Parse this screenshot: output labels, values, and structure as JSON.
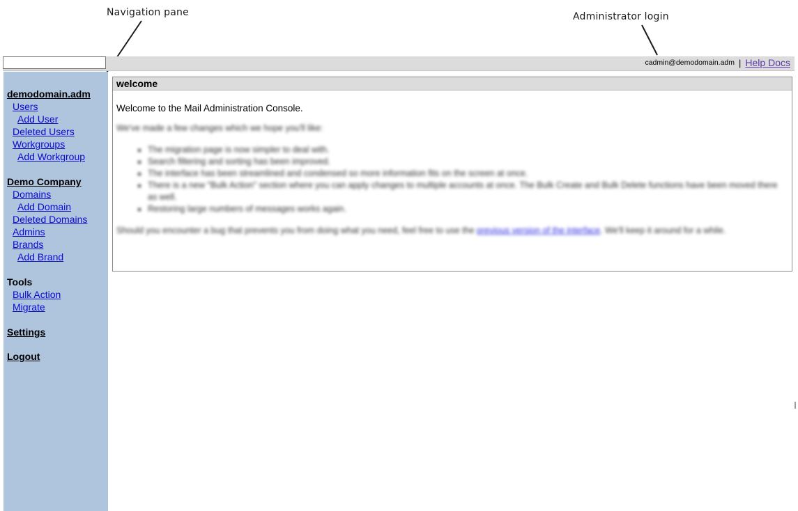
{
  "annotations": {
    "navigation_pane": "Navigation pane",
    "administrator_login": "Administrator login"
  },
  "topbar": {
    "search_value": "",
    "user_email": "cadmin@demodomain.adm",
    "separator": "|",
    "help_label": "Help Docs"
  },
  "sidebar": {
    "domain": {
      "heading": "demodomain.adm",
      "items": [
        "Users",
        "Add User",
        "Deleted Users",
        "Workgroups",
        "Add Workgroup"
      ]
    },
    "company": {
      "heading": "Demo Company",
      "items": [
        "Domains",
        "Add Domain",
        "Deleted Domains",
        "Admins",
        "Brands",
        "Add Brand"
      ]
    },
    "tools": {
      "heading": "Tools",
      "items": [
        "Bulk Action",
        "Migrate"
      ]
    },
    "settings_label": "Settings",
    "logout_label": "Logout"
  },
  "panel": {
    "title": "welcome",
    "welcome_text": "Welcome to the Mail Administration Console.",
    "intro_text": "We've made a few changes which we hope you'll like:",
    "changes": [
      "The migration page is now simpler to deal with.",
      "Search filtering and sorting has been improved.",
      "The interface has been streamlined and condensed so more information fits on the screen at once.",
      "There is a new \"Bulk Action\" section where you can apply changes to multiple accounts at once. The Bulk Create and Bulk Delete functions have been moved there as well.",
      "Restoring large numbers of messages works again."
    ],
    "footer_before": "Should you encounter a bug that prevents you from doing what you need, feel free to use the",
    "footer_link": "previous version of the interface",
    "footer_after": ". We'll keep it around for a while."
  },
  "colors": {
    "sidebar_bg": "#afc4dd",
    "link": "#0a0ad1",
    "help_link": "#5a37a6",
    "bar_bg": "#dcdcdc"
  }
}
